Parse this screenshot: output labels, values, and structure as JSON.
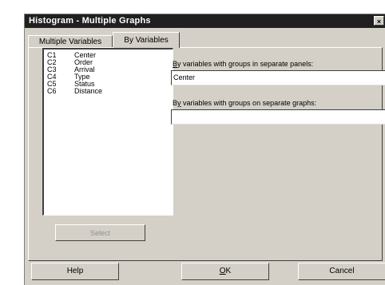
{
  "window": {
    "title": "Histogram - Multiple Graphs",
    "close_glyph": "×"
  },
  "tabs": [
    {
      "label": "Multiple Variables"
    },
    {
      "label": "By Variables"
    }
  ],
  "variables": [
    {
      "id": "C1",
      "name": "Center"
    },
    {
      "id": "C2",
      "name": "Order"
    },
    {
      "id": "C3",
      "name": "Arrival"
    },
    {
      "id": "C4",
      "name": "Type"
    },
    {
      "id": "C5",
      "name": "Status"
    },
    {
      "id": "C6",
      "name": "Distance"
    }
  ],
  "select_button": {
    "label": "Select"
  },
  "panels_field": {
    "label_key": "B",
    "label_rest": "y variables with groups in separate panels:",
    "value": "Center"
  },
  "graphs_field": {
    "label_first": "B",
    "label_key": "y",
    "label_rest": " variables with groups on separate graphs:",
    "value": ""
  },
  "buttons": {
    "help": "Help",
    "ok_key": "O",
    "ok_rest": "K",
    "cancel": "Cancel"
  }
}
